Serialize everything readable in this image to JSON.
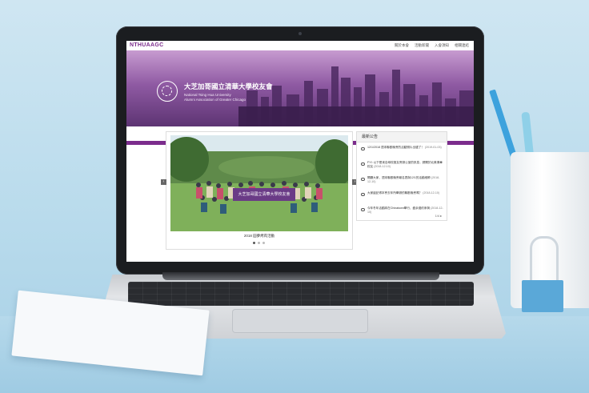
{
  "site": {
    "brand": "NTHUAAGC",
    "nav": [
      "關於本會",
      "活動新聞",
      "入會須知",
      "相關連結"
    ],
    "hero_title": "大芝加哥國立清華大學校友會",
    "hero_subtitle_line1": "National Tsing Hua University",
    "hero_subtitle_line2": "Alumni Association of Greater Chicago"
  },
  "slider": {
    "caption": "2018 圓夢烤肉活動",
    "banner_text": "大芝加哥國立清華大學校友會",
    "prev_icon": "chevron-left-icon",
    "next_icon": "chevron-right-icon"
  },
  "news": {
    "heading": "最新公告",
    "items": [
      {
        "text": "12/1/2018 週末聯歡晚會的活動照片出爐了！",
        "date": "(2019-01-03)"
      },
      {
        "text": "FYI: 以下是來自母校推友會辦公室的訊息，請關於北美清華校友",
        "date": "(2018-12-10)"
      },
      {
        "text": "開闢大家，週末聯歡晚會報名表與12/1的活動細節",
        "date": "(2018-12-10)"
      },
      {
        "text": "大家還記得本會去年所舉辦的聯歡晚會嗎？",
        "date": "(2018-12-10)"
      },
      {
        "text": "今年冬年活動將在Chinatown舉行，盛余邀約參與",
        "date": "(2018-12-10)"
      }
    ],
    "pager": "1/4 ▸"
  },
  "colors": {
    "brand_purple": "#7b2c8c",
    "hero_gradient_top": "#c79bd0",
    "hero_gradient_bottom": "#5d3473",
    "background_blue": "#b9dbec"
  }
}
